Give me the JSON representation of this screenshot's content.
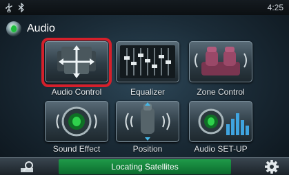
{
  "status_bar": {
    "usb_icon": "usb-icon",
    "bluetooth_icon": "bluetooth-icon",
    "clock": "4:25"
  },
  "header": {
    "title": "Audio",
    "icon": "speaker-icon"
  },
  "tiles": [
    {
      "label": "Audio Control",
      "icon": "audio-control-icon",
      "selected": true
    },
    {
      "label": "Equalizer",
      "icon": "equalizer-icon",
      "selected": false
    },
    {
      "label": "Zone Control",
      "icon": "zone-control-icon",
      "selected": false
    },
    {
      "label": "Sound Effect",
      "icon": "sound-effect-icon",
      "selected": false
    },
    {
      "label": "Position",
      "icon": "position-icon",
      "selected": false
    },
    {
      "label": "Audio SET-UP",
      "icon": "audio-setup-icon",
      "selected": false
    }
  ],
  "bottom_bar": {
    "search_icon": "search-icon",
    "status": "Locating Satellites",
    "settings_icon": "gear-icon"
  },
  "colors": {
    "selection_frame": "#d4202b",
    "status_green": "#1f9a49",
    "speaker_green": "#1dbb3c",
    "background": "#1b2c38"
  }
}
